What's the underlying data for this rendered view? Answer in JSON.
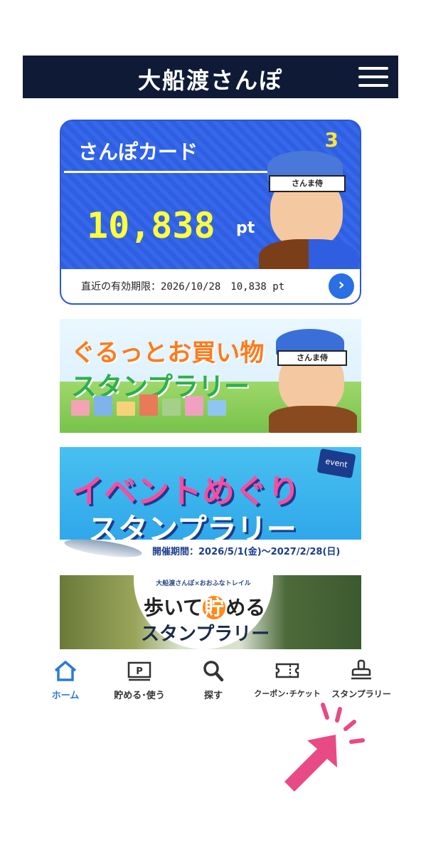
{
  "header": {
    "title": "大船渡さんぽ"
  },
  "card": {
    "title": "さんぽカード",
    "count": "3",
    "points": "10,838",
    "points_unit": "pt",
    "expiry_text": "直近の有効期限：2026/10/28　10,838 pt",
    "character_band": "さんま侍"
  },
  "banners": {
    "gurutto": {
      "line1": "ぐるっとお買い物",
      "line2": "スタンプラリー",
      "character_band": "さんま侍"
    },
    "event": {
      "line1": "イベントめぐり",
      "line2": "スタンプラリー",
      "period": "開催期間：2026/5/1(金)〜2027/2/28(日)",
      "tag": "event"
    },
    "walk": {
      "top": "大船渡さんぽ×おおふなトレイル",
      "line1_pre": "歩いて",
      "line1_hl": "貯",
      "line1_post": "める",
      "line2": "スタンプラリー"
    }
  },
  "tabs": [
    {
      "label": "ホーム",
      "icon": "home-icon",
      "active": true
    },
    {
      "label": "貯める･使う",
      "icon": "point-card-icon",
      "active": false
    },
    {
      "label": "探す",
      "icon": "search-icon",
      "active": false
    },
    {
      "label": "クーポン･チケット",
      "icon": "ticket-icon",
      "active": false
    },
    {
      "label": "スタンプラリー",
      "icon": "stamp-icon",
      "active": false
    }
  ],
  "colors": {
    "header_bg": "#0f1b36",
    "card_blue": "#2f5fe0",
    "points_yellow": "#ffff3a",
    "active_tab": "#2d7ad6",
    "pointer_pink": "#e84a86"
  }
}
